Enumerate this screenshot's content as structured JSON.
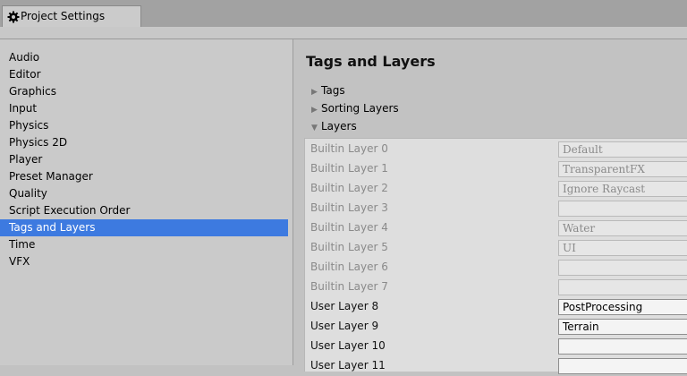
{
  "window": {
    "tab_label": "Project Settings",
    "tab_icon": "gear-icon"
  },
  "sidebar": {
    "items": [
      {
        "label": "Audio",
        "selected": false
      },
      {
        "label": "Editor",
        "selected": false
      },
      {
        "label": "Graphics",
        "selected": false
      },
      {
        "label": "Input",
        "selected": false
      },
      {
        "label": "Physics",
        "selected": false
      },
      {
        "label": "Physics 2D",
        "selected": false
      },
      {
        "label": "Player",
        "selected": false
      },
      {
        "label": "Preset Manager",
        "selected": false
      },
      {
        "label": "Quality",
        "selected": false
      },
      {
        "label": "Script Execution Order",
        "selected": false
      },
      {
        "label": "Tags and Layers",
        "selected": true
      },
      {
        "label": "Time",
        "selected": false
      },
      {
        "label": "VFX",
        "selected": false
      }
    ],
    "selected_color": "#3d7ae0"
  },
  "main": {
    "title": "Tags and Layers",
    "foldouts": [
      {
        "label": "Tags",
        "expanded": false,
        "arrow": "▶"
      },
      {
        "label": "Sorting Layers",
        "expanded": false,
        "arrow": "▶"
      },
      {
        "label": "Layers",
        "expanded": true,
        "arrow": "▼"
      }
    ],
    "layers": [
      {
        "label": "Builtin Layer 0",
        "value": "Default",
        "builtin": true
      },
      {
        "label": "Builtin Layer 1",
        "value": "TransparentFX",
        "builtin": true
      },
      {
        "label": "Builtin Layer 2",
        "value": "Ignore Raycast",
        "builtin": true
      },
      {
        "label": "Builtin Layer 3",
        "value": "",
        "builtin": true
      },
      {
        "label": "Builtin Layer 4",
        "value": "Water",
        "builtin": true
      },
      {
        "label": "Builtin Layer 5",
        "value": "UI",
        "builtin": true
      },
      {
        "label": "Builtin Layer 6",
        "value": "",
        "builtin": true
      },
      {
        "label": "Builtin Layer 7",
        "value": "",
        "builtin": true
      },
      {
        "label": "User Layer 8",
        "value": "PostProcessing",
        "builtin": false
      },
      {
        "label": "User Layer 9",
        "value": "Terrain",
        "builtin": false
      },
      {
        "label": "User Layer 10",
        "value": "",
        "builtin": false
      },
      {
        "label": "User Layer 11",
        "value": "",
        "builtin": false
      }
    ]
  }
}
